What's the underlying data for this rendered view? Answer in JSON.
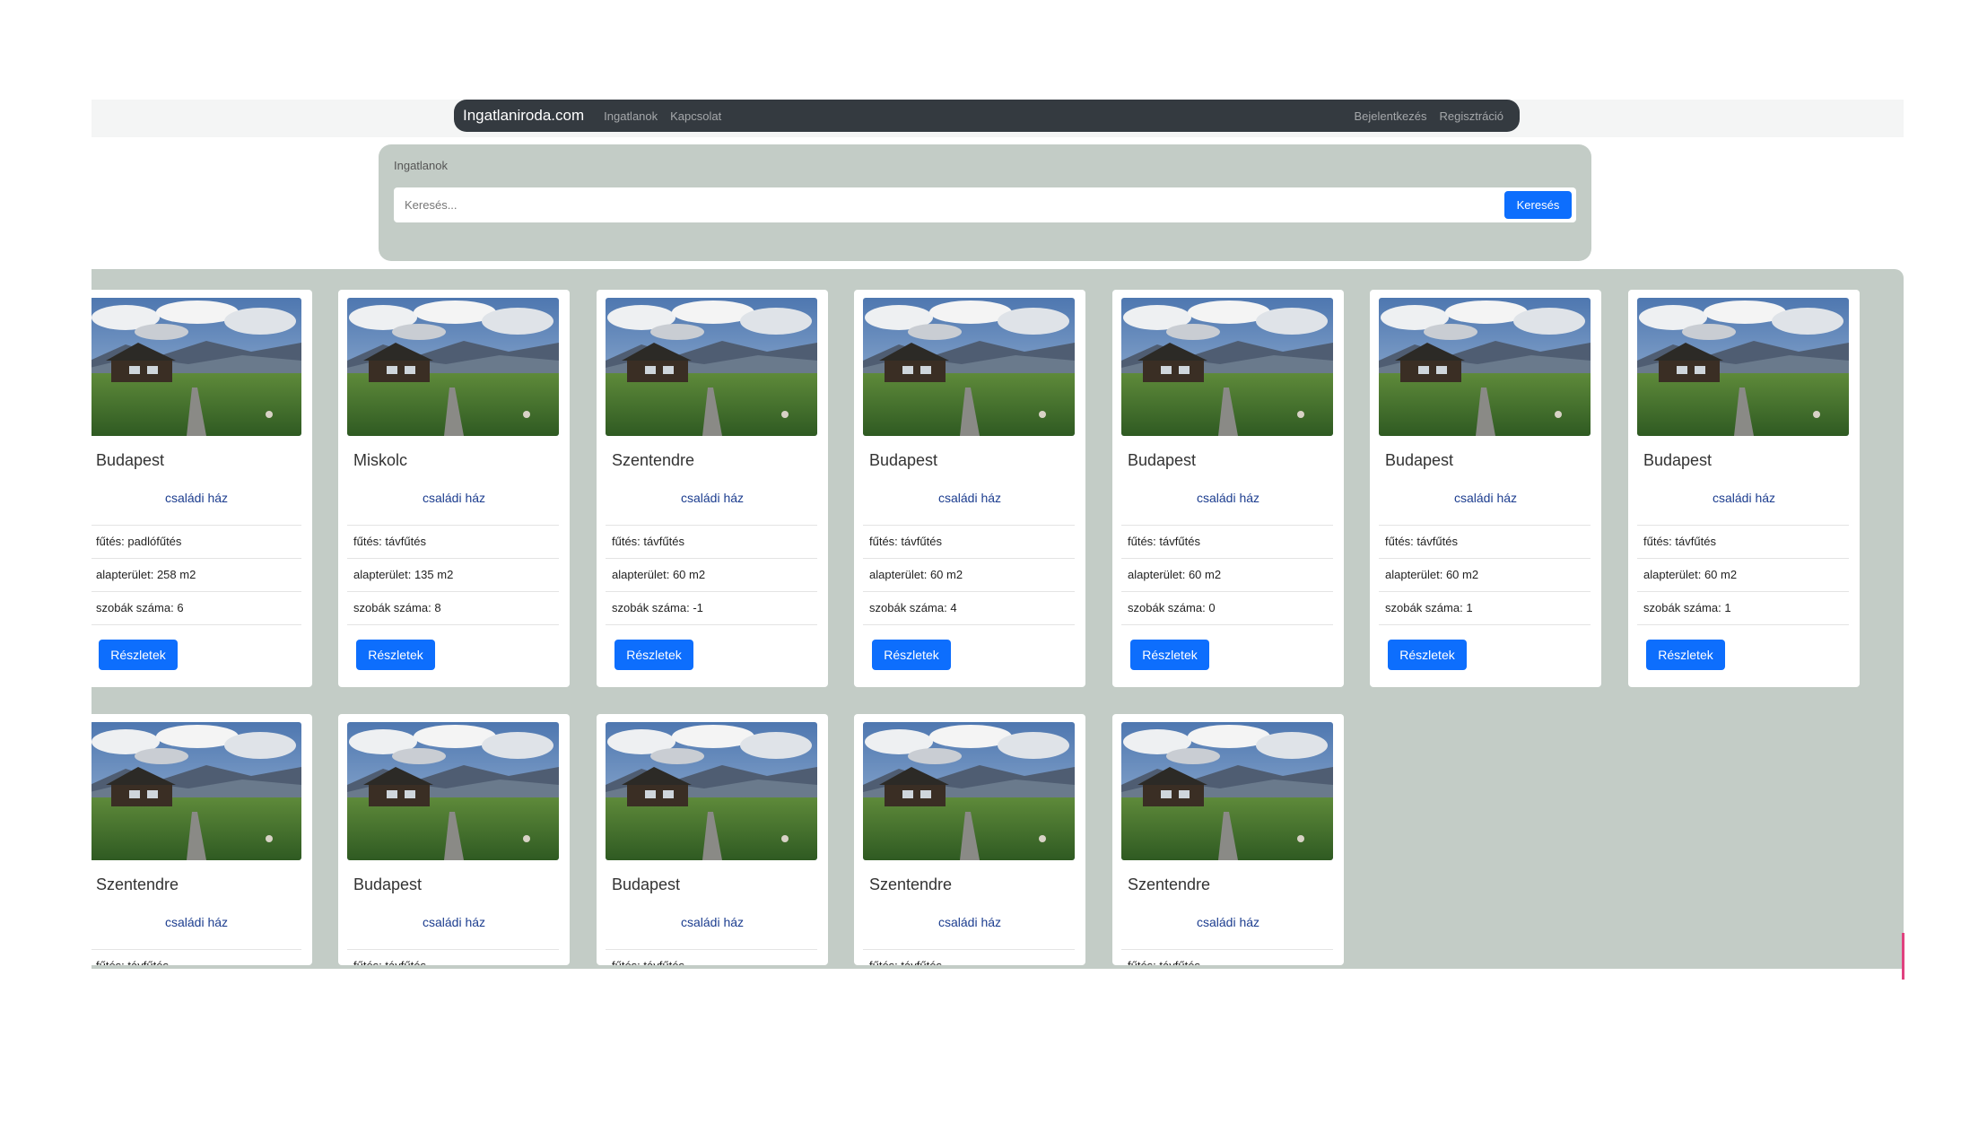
{
  "navbar": {
    "brand": "Ingatlaniroda.com",
    "links": [
      "Ingatlanok",
      "Kapcsolat"
    ],
    "right_links": [
      "Bejelentkezés",
      "Regisztráció"
    ]
  },
  "search": {
    "title": "Ingatlanok",
    "placeholder": "Keresés...",
    "button_label": "Keresés"
  },
  "colors": {
    "accent": "#0d6efd",
    "navbar": "#343a40",
    "panel": "#c3ccc6"
  },
  "labels": {
    "heating": "fűtés:",
    "area": "alapterület:",
    "area_unit": "m2",
    "rooms": "szobák száma:",
    "details": "Részletek"
  },
  "listings": [
    {
      "city": "Budapest",
      "type": "családi ház",
      "heating": "padlófűtés",
      "area": "258",
      "rooms": "6"
    },
    {
      "city": "Miskolc",
      "type": "családi ház",
      "heating": "távfűtés",
      "area": "135",
      "rooms": "8"
    },
    {
      "city": "Szentendre",
      "type": "családi ház",
      "heating": "távfűtés",
      "area": "60",
      "rooms": "-1"
    },
    {
      "city": "Budapest",
      "type": "családi ház",
      "heating": "távfűtés",
      "area": "60",
      "rooms": "4"
    },
    {
      "city": "Budapest",
      "type": "családi ház",
      "heating": "távfűtés",
      "area": "60",
      "rooms": "0"
    },
    {
      "city": "Budapest",
      "type": "családi ház",
      "heating": "távfűtés",
      "area": "60",
      "rooms": "1"
    },
    {
      "city": "Budapest",
      "type": "családi ház",
      "heating": "távfűtés",
      "area": "60",
      "rooms": "1"
    },
    {
      "city": "Szentendre",
      "type": "családi ház",
      "heating": "távfűtés"
    },
    {
      "city": "Budapest",
      "type": "családi ház",
      "heating": "távfűtés"
    },
    {
      "city": "Budapest",
      "type": "családi ház",
      "heating": "távfűtés"
    },
    {
      "city": "Szentendre",
      "type": "családi ház",
      "heating": "távfűtés"
    },
    {
      "city": "Szentendre",
      "type": "családi ház",
      "heating": "távfűtés"
    }
  ]
}
